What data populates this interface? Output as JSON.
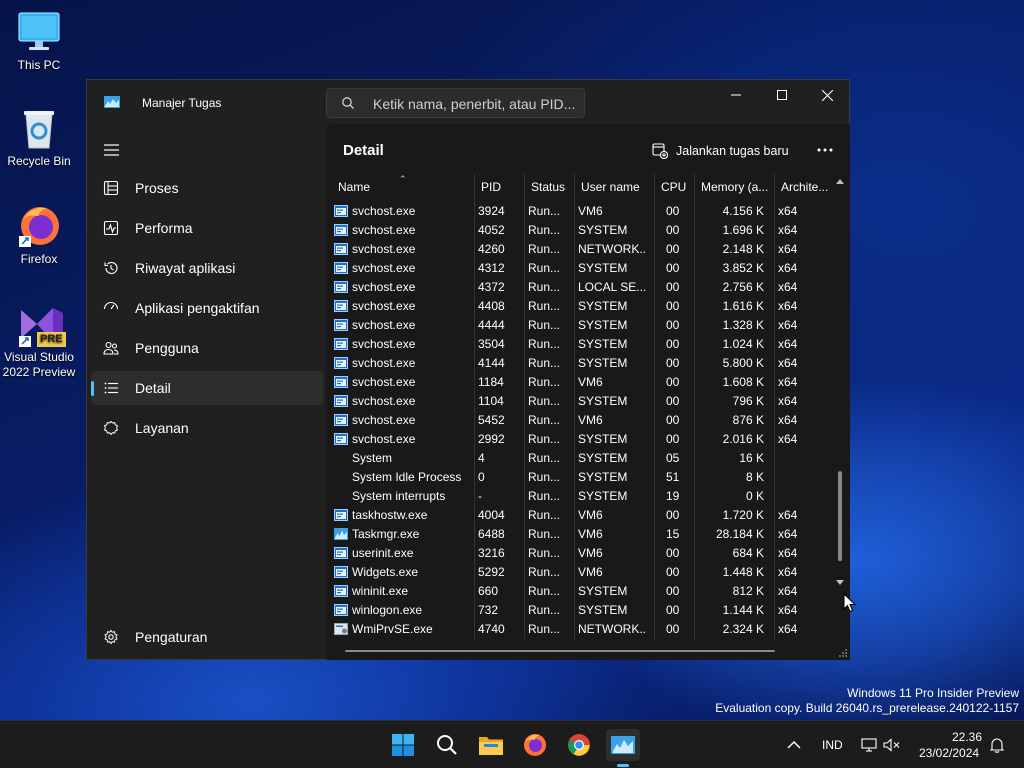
{
  "desktop": {
    "icons": [
      {
        "label": "This PC"
      },
      {
        "label": "Recycle Bin"
      },
      {
        "label": "Firefox"
      },
      {
        "label": "Visual Studio 2022 Preview",
        "badge": "PRE"
      }
    ],
    "watermark": {
      "line1": "Windows 11 Pro Insider Preview",
      "line2": "Evaluation copy. Build 26040.rs_prerelease.240122-1157"
    }
  },
  "window": {
    "title": "Manajer Tugas",
    "search_placeholder": "Ketik nama, penerbit, atau PID...",
    "controls": [
      "minimize-icon",
      "maximize-icon",
      "close-icon"
    ]
  },
  "nav": {
    "items": [
      {
        "label": "Proses",
        "icon": "processes-icon"
      },
      {
        "label": "Performa",
        "icon": "performance-icon"
      },
      {
        "label": "Riwayat aplikasi",
        "icon": "app-history-icon"
      },
      {
        "label": "Aplikasi pengaktifan",
        "icon": "startup-apps-icon"
      },
      {
        "label": "Pengguna",
        "icon": "users-icon"
      },
      {
        "label": "Detail",
        "icon": "details-icon",
        "active": true
      },
      {
        "label": "Layanan",
        "icon": "services-icon"
      }
    ],
    "settings_label": "Pengaturan"
  },
  "page": {
    "title": "Detail",
    "run_new_task_label": "Jalankan tugas baru",
    "accent": "#4cc2ff"
  },
  "table": {
    "columns": [
      "Name",
      "PID",
      "Status",
      "User name",
      "CPU",
      "Memory (a...",
      "Archite..."
    ],
    "rows": [
      {
        "name": "svchost.exe",
        "pid": "3924",
        "status": "Run...",
        "user": "VM6",
        "cpu": "00",
        "mem": "4.156 K",
        "arch": "x64",
        "icon": "service-host"
      },
      {
        "name": "svchost.exe",
        "pid": "4052",
        "status": "Run...",
        "user": "SYSTEM",
        "cpu": "00",
        "mem": "1.696 K",
        "arch": "x64",
        "icon": "service-host"
      },
      {
        "name": "svchost.exe",
        "pid": "4260",
        "status": "Run...",
        "user": "NETWORK...",
        "cpu": "00",
        "mem": "2.148 K",
        "arch": "x64",
        "icon": "service-host"
      },
      {
        "name": "svchost.exe",
        "pid": "4312",
        "status": "Run...",
        "user": "SYSTEM",
        "cpu": "00",
        "mem": "3.852 K",
        "arch": "x64",
        "icon": "service-host"
      },
      {
        "name": "svchost.exe",
        "pid": "4372",
        "status": "Run...",
        "user": "LOCAL SE...",
        "cpu": "00",
        "mem": "2.756 K",
        "arch": "x64",
        "icon": "service-host"
      },
      {
        "name": "svchost.exe",
        "pid": "4408",
        "status": "Run...",
        "user": "SYSTEM",
        "cpu": "00",
        "mem": "1.616 K",
        "arch": "x64",
        "icon": "service-host"
      },
      {
        "name": "svchost.exe",
        "pid": "4444",
        "status": "Run...",
        "user": "SYSTEM",
        "cpu": "00",
        "mem": "1.328 K",
        "arch": "x64",
        "icon": "service-host"
      },
      {
        "name": "svchost.exe",
        "pid": "3504",
        "status": "Run...",
        "user": "SYSTEM",
        "cpu": "00",
        "mem": "1.024 K",
        "arch": "x64",
        "icon": "service-host"
      },
      {
        "name": "svchost.exe",
        "pid": "4144",
        "status": "Run...",
        "user": "SYSTEM",
        "cpu": "00",
        "mem": "5.800 K",
        "arch": "x64",
        "icon": "service-host"
      },
      {
        "name": "svchost.exe",
        "pid": "1184",
        "status": "Run...",
        "user": "VM6",
        "cpu": "00",
        "mem": "1.608 K",
        "arch": "x64",
        "icon": "service-host"
      },
      {
        "name": "svchost.exe",
        "pid": "1104",
        "status": "Run...",
        "user": "SYSTEM",
        "cpu": "00",
        "mem": "796 K",
        "arch": "x64",
        "icon": "service-host"
      },
      {
        "name": "svchost.exe",
        "pid": "5452",
        "status": "Run...",
        "user": "VM6",
        "cpu": "00",
        "mem": "876 K",
        "arch": "x64",
        "icon": "service-host"
      },
      {
        "name": "svchost.exe",
        "pid": "2992",
        "status": "Run...",
        "user": "SYSTEM",
        "cpu": "00",
        "mem": "2.016 K",
        "arch": "x64",
        "icon": "service-host"
      },
      {
        "name": "System",
        "pid": "4",
        "status": "Run...",
        "user": "SYSTEM",
        "cpu": "05",
        "mem": "16 K",
        "arch": "",
        "icon": "none"
      },
      {
        "name": "System Idle Process",
        "pid": "0",
        "status": "Run...",
        "user": "SYSTEM",
        "cpu": "51",
        "mem": "8 K",
        "arch": "",
        "icon": "none"
      },
      {
        "name": "System interrupts",
        "pid": "-",
        "status": "Run...",
        "user": "SYSTEM",
        "cpu": "19",
        "mem": "0 K",
        "arch": "",
        "icon": "none"
      },
      {
        "name": "taskhostw.exe",
        "pid": "4004",
        "status": "Run...",
        "user": "VM6",
        "cpu": "00",
        "mem": "1.720 K",
        "arch": "x64",
        "icon": "service-host"
      },
      {
        "name": "Taskmgr.exe",
        "pid": "6488",
        "status": "Run...",
        "user": "VM6",
        "cpu": "15",
        "mem": "28.184 K",
        "arch": "x64",
        "icon": "task-manager"
      },
      {
        "name": "userinit.exe",
        "pid": "3216",
        "status": "Run...",
        "user": "VM6",
        "cpu": "00",
        "mem": "684 K",
        "arch": "x64",
        "icon": "service-host"
      },
      {
        "name": "Widgets.exe",
        "pid": "5292",
        "status": "Run...",
        "user": "VM6",
        "cpu": "00",
        "mem": "1.448 K",
        "arch": "x64",
        "icon": "service-host"
      },
      {
        "name": "wininit.exe",
        "pid": "660",
        "status": "Run...",
        "user": "SYSTEM",
        "cpu": "00",
        "mem": "812 K",
        "arch": "x64",
        "icon": "service-host"
      },
      {
        "name": "winlogon.exe",
        "pid": "732",
        "status": "Run...",
        "user": "SYSTEM",
        "cpu": "00",
        "mem": "1.144 K",
        "arch": "x64",
        "icon": "service-host"
      },
      {
        "name": "WmiPrvSE.exe",
        "pid": "4740",
        "status": "Run...",
        "user": "NETWORK...",
        "cpu": "00",
        "mem": "2.324 K",
        "arch": "x64",
        "icon": "wmi"
      }
    ],
    "vertical_scroll_position": 0.95
  },
  "taskbar": {
    "apps": [
      "start-icon",
      "search-icon",
      "file-explorer-icon",
      "firefox-icon",
      "chrome-icon",
      "task-manager-icon"
    ],
    "language": "IND",
    "time": "22.36",
    "date": "23/02/2024"
  }
}
